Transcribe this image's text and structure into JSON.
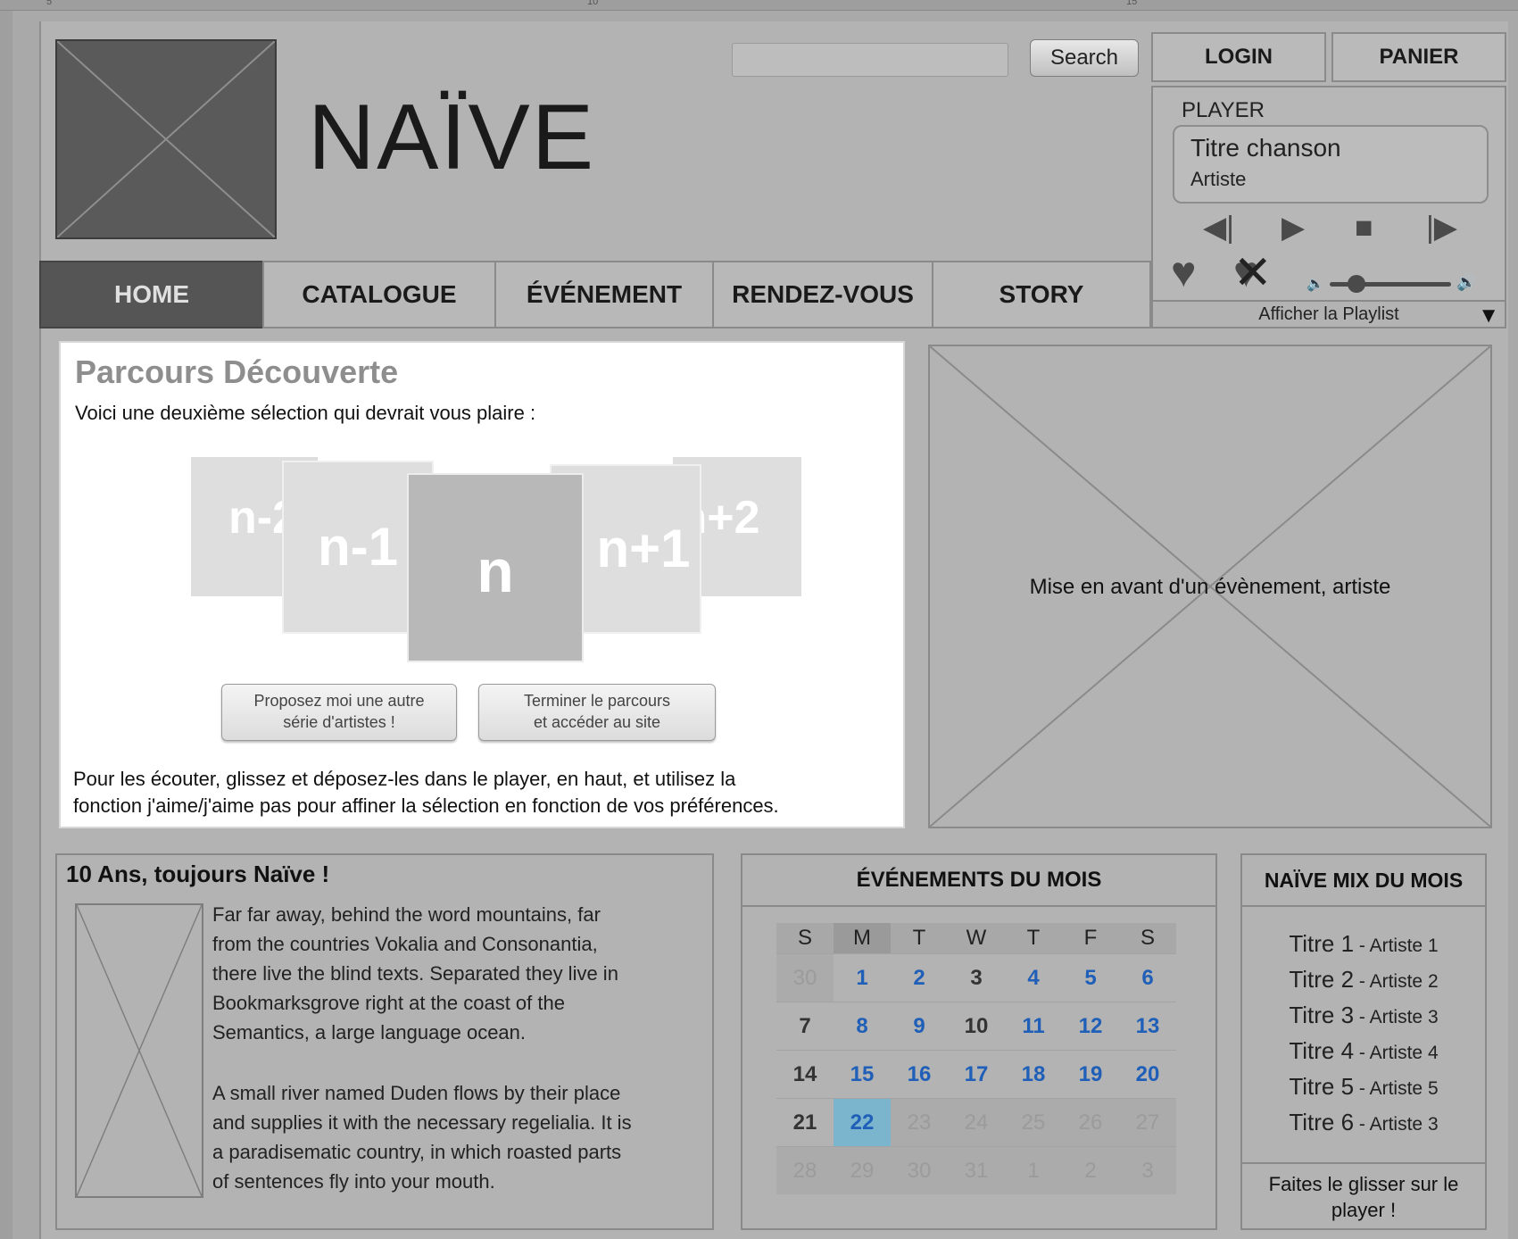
{
  "ruler": {
    "marks": [
      "5",
      "10",
      "15"
    ]
  },
  "header": {
    "brand": "NAÏVE",
    "search": {
      "placeholder": "",
      "button_label": "Search"
    },
    "login_label": "LOGIN",
    "cart_label": "PANIER"
  },
  "player": {
    "label": "PLAYER",
    "song_title": "Titre chanson",
    "song_artist": "Artiste",
    "controls": [
      "previous-icon",
      "play-icon",
      "stop-icon",
      "next-icon"
    ],
    "volume_level": 0.22,
    "playlist_label": "Afficher la Playlist"
  },
  "nav": {
    "tabs": [
      {
        "label": "HOME",
        "active": true
      },
      {
        "label": "CATALOGUE",
        "active": false
      },
      {
        "label": "ÉVÉNEMENT",
        "active": false
      },
      {
        "label": "RENDEZ-VOUS",
        "active": false
      },
      {
        "label": "STORY",
        "active": false
      }
    ]
  },
  "parcours": {
    "title": "Parcours Découverte",
    "subtitle": "Voici une deuxième sélection qui devrait vous plaire :",
    "cards": [
      "n-2",
      "n-1",
      "n",
      "n+1",
      "n+2"
    ],
    "button_more_line1": "Proposez moi une autre",
    "button_more_line2": "série d'artistes !",
    "button_finish_line1": "Terminer le parcours",
    "button_finish_line2": "et accéder au site",
    "note_line1": "Pour les écouter, glissez et déposez-les dans le player, en haut, et utilisez la",
    "note_line2": "fonction j'aime/j'aime pas pour affiner la sélection en fonction de vos préférences."
  },
  "feature": {
    "label": "Mise en avant d'un évènement, artiste"
  },
  "tenans": {
    "title": "10 Ans, toujours Naïve !",
    "paragraph1": [
      "Far far away, behind the word mountains, far",
      "from the countries Vokalia and Consonantia,",
      "there live the blind texts. Separated they live in",
      "Bookmarksgrove right at the coast of the",
      "Semantics, a large language ocean."
    ],
    "paragraph2": [
      "A small river named Duden flows by their place",
      "and supplies it with the necessary regelialia. It is",
      "a paradisematic country, in which roasted parts",
      "of sentences fly into your mouth."
    ]
  },
  "calendar": {
    "title": "ÉVÉNEMENTS DU MOIS",
    "weekdays": [
      "S",
      "M",
      "T",
      "W",
      "T",
      "F",
      "S"
    ],
    "weeks": [
      [
        {
          "d": "30",
          "s": "faded"
        },
        {
          "d": "1",
          "s": "blue"
        },
        {
          "d": "2",
          "s": "blue"
        },
        {
          "d": "3",
          "s": "dark"
        },
        {
          "d": "4",
          "s": "blue"
        },
        {
          "d": "5",
          "s": "blue"
        },
        {
          "d": "6",
          "s": "blue"
        }
      ],
      [
        {
          "d": "7",
          "s": "dark"
        },
        {
          "d": "8",
          "s": "blue"
        },
        {
          "d": "9",
          "s": "blue"
        },
        {
          "d": "10",
          "s": "dark"
        },
        {
          "d": "11",
          "s": "blue"
        },
        {
          "d": "12",
          "s": "blue"
        },
        {
          "d": "13",
          "s": "blue"
        }
      ],
      [
        {
          "d": "14",
          "s": "dark"
        },
        {
          "d": "15",
          "s": "blue"
        },
        {
          "d": "16",
          "s": "blue"
        },
        {
          "d": "17",
          "s": "blue"
        },
        {
          "d": "18",
          "s": "blue"
        },
        {
          "d": "19",
          "s": "blue"
        },
        {
          "d": "20",
          "s": "blue"
        }
      ],
      [
        {
          "d": "21",
          "s": "dark"
        },
        {
          "d": "22",
          "s": "today"
        },
        {
          "d": "23",
          "s": "faded"
        },
        {
          "d": "24",
          "s": "faded"
        },
        {
          "d": "25",
          "s": "faded"
        },
        {
          "d": "26",
          "s": "faded"
        },
        {
          "d": "27",
          "s": "faded"
        }
      ],
      [
        {
          "d": "28",
          "s": "faded"
        },
        {
          "d": "29",
          "s": "faded"
        },
        {
          "d": "30",
          "s": "faded"
        },
        {
          "d": "31",
          "s": "faded"
        },
        {
          "d": "1",
          "s": "faded"
        },
        {
          "d": "2",
          "s": "faded"
        },
        {
          "d": "3",
          "s": "faded"
        }
      ]
    ]
  },
  "mix": {
    "title": "NAÏVE MIX DU MOIS",
    "items": [
      {
        "title": "Titre 1",
        "artist": "Artiste 1"
      },
      {
        "title": "Titre 2",
        "artist": "Artiste 2"
      },
      {
        "title": "Titre 3",
        "artist": "Artiste 3"
      },
      {
        "title": "Titre 4",
        "artist": "Artiste 4"
      },
      {
        "title": "Titre 5",
        "artist": "Artiste 5"
      },
      {
        "title": "Titre 6",
        "artist": "Artiste 3"
      }
    ],
    "separator": " - ",
    "footer_line1": "Faites le glisser sur le",
    "footer_line2": "player !"
  },
  "colors": {
    "active_tab": "#555555",
    "calendar_link": "#1f5fb8",
    "calendar_today": "#7bb5cd"
  }
}
